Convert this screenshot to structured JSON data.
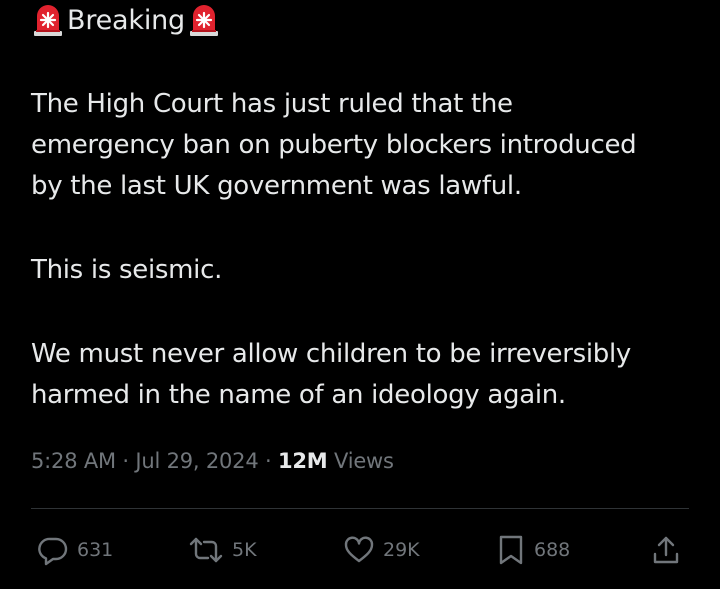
{
  "header": {
    "left_icon": "police-car-light-icon",
    "label": "Breaking",
    "right_icon": "police-car-light-icon"
  },
  "post": {
    "paragraphs": [
      "The High Court has just ruled that the\nemergency ban on puberty blockers introduced\nby the last UK government was lawful.",
      "This is seismic.",
      "We must never allow children to be irreversibly\nharmed in the name of an ideology again."
    ],
    "time": "5:28 AM",
    "separator": "·",
    "date": "Jul 29, 2024",
    "views_count": "12M",
    "views_label": "Views"
  },
  "actions": {
    "replies": {
      "icon": "reply-icon",
      "count": "631"
    },
    "reposts": {
      "icon": "repost-icon",
      "count": "5K"
    },
    "likes": {
      "icon": "heart-icon",
      "count": "29K"
    },
    "bookmarks": {
      "icon": "bookmark-icon",
      "count": "688"
    },
    "share": {
      "icon": "share-icon"
    }
  },
  "colors": {
    "background": "#000000",
    "text": "#e7e9ea",
    "secondary": "#71767b",
    "divider": "#2f3336",
    "siren_red": "#e0222e"
  }
}
